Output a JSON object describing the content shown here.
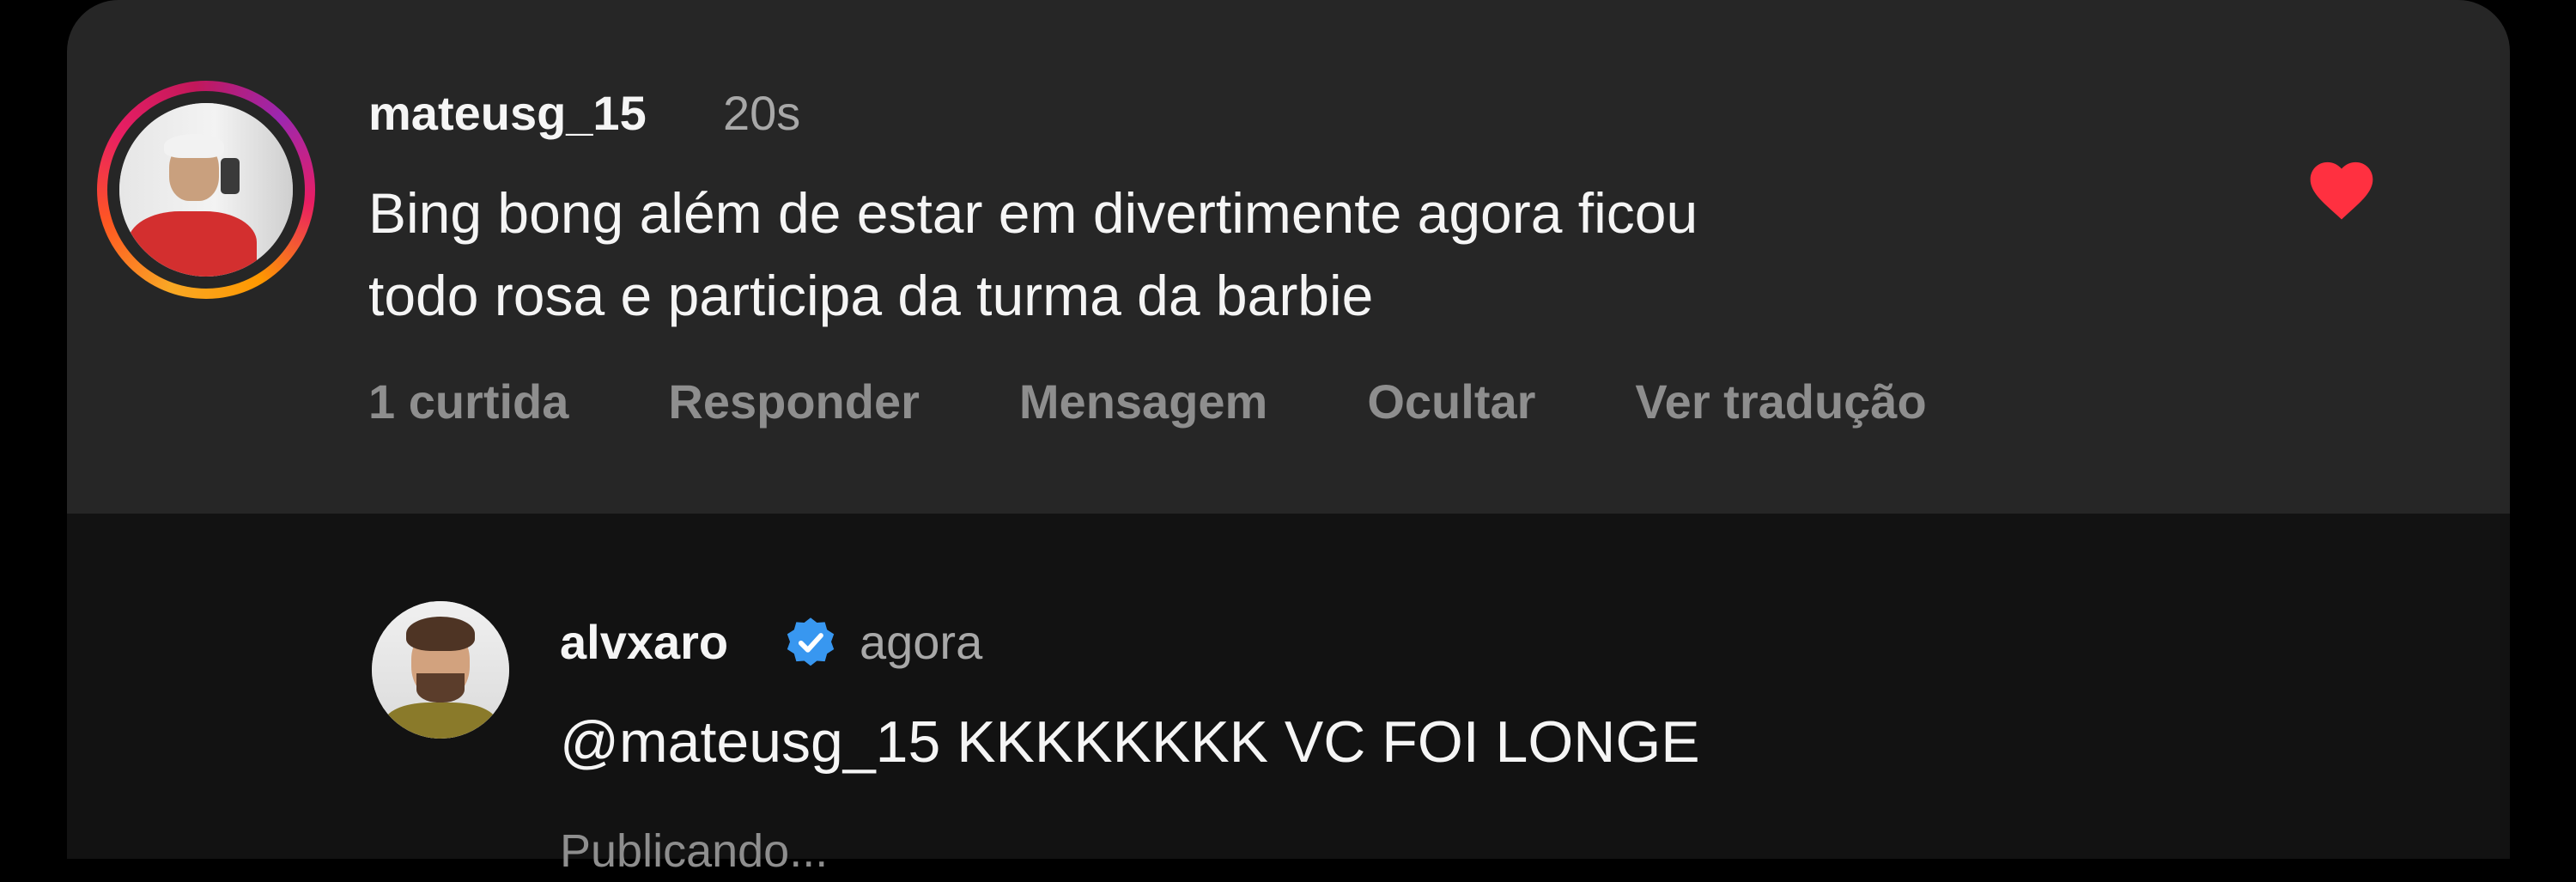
{
  "comment": {
    "username": "mateusg_15",
    "time": "20s",
    "text_line1": "Bing bong além de estar em divertimente agora ficou",
    "text_line2": "todo rosa e participa da turma da barbie",
    "actions": {
      "likes": "1 curtida",
      "reply": "Responder",
      "message": "Mensagem",
      "hide": "Ocultar",
      "translate": "Ver tradução"
    },
    "liked": true,
    "heart_color": "#ff3040"
  },
  "reply": {
    "username": "alvxaro",
    "verified": true,
    "verified_color": "#3897f0",
    "time": "agora",
    "text": "@mateusg_15 KKKKKKKK VC FOI LONGE",
    "status": "Publicando..."
  },
  "icons": {
    "like": "heart-icon",
    "verified": "verified-badge-icon"
  }
}
